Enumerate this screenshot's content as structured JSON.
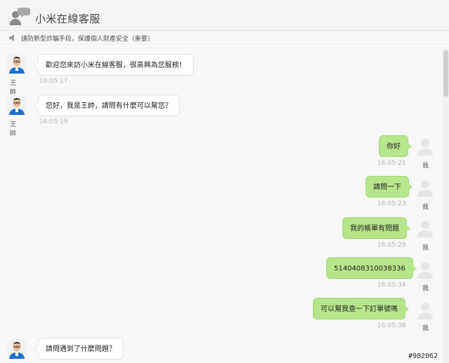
{
  "header": {
    "title": "小米在線客服",
    "logo_icon": "chat-bubbles-person-icon"
  },
  "notice": {
    "icon": "speaker-icon",
    "text": "謹防新型詐騙手段，保護個人財產安全（重要）"
  },
  "agent_name": "王帥",
  "me_name": "我",
  "messages": [
    {
      "from": "agent",
      "text": "歡迎您來訪小米在線客服，很高興為您服務！",
      "time": "16:05:17"
    },
    {
      "from": "agent",
      "text": "您好，我是王帥，請問有什麼可以幫您？",
      "time": "16:05:19"
    },
    {
      "from": "me",
      "text": "你好",
      "time": "16:05:21"
    },
    {
      "from": "me",
      "text": "請問一下",
      "time": "16:05:23"
    },
    {
      "from": "me",
      "text": "我的帳單有問題",
      "time": "16:05:29"
    },
    {
      "from": "me",
      "text": "5140408310038336",
      "time": "16:05:34"
    },
    {
      "from": "me",
      "text": "可以幫我查一下訂單號嗎",
      "time": "16:05:38"
    },
    {
      "from": "agent",
      "text": "請問遇到了什麼問題？",
      "time": ""
    }
  ],
  "watermark": "#982062",
  "colors": {
    "agent_bubble": "#ffffff",
    "me_bubble": "#b6e68c",
    "timestamp": "#b5b5b5"
  }
}
